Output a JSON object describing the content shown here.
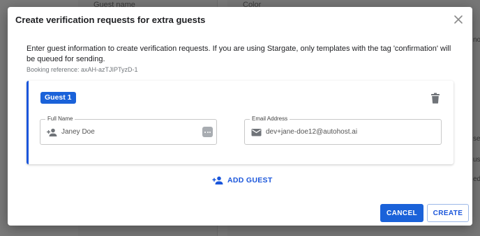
{
  "background": {
    "left_header": "Guest name",
    "right_header": "Color",
    "side_fragments": [
      "no",
      "ser",
      "ust",
      "eds"
    ]
  },
  "dialog": {
    "title": "Create verification requests for extra guests",
    "close_icon": "close-icon",
    "intro": "Enter guest information to create verification requests. If you are using Stargate, only templates with the tag 'confirmation' will be queued for sending.",
    "booking_reference": "Booking reference: axAH-azTJIPTyzD-1",
    "guests": [
      {
        "chip_label": "Guest 1",
        "full_name_label": "Full Name",
        "full_name_value": "Janey Doe",
        "email_label": "Email Address",
        "email_value": "dev+jane-doe12@autohost.ai"
      }
    ],
    "add_guest_label": "ADD GUEST",
    "cancel_label": "CANCEL",
    "create_label": "CREATE"
  },
  "colors": {
    "accent": "#1a62d9",
    "accent_text": "#1a56db",
    "overlay": "#7a7a7a"
  }
}
